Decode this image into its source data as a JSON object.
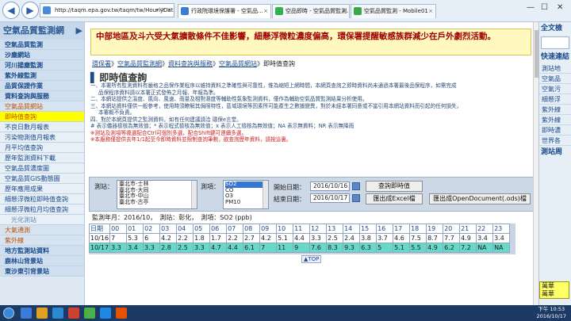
{
  "browser": {
    "url": "http://taqm.epa.gov.tw/taqm/tw/HourlyData.aspx",
    "tabs": [
      {
        "label": "行政院環境保護署 - 空氣品...",
        "color": "#3a7bd5"
      },
      {
        "label": "空品即時 - 空氣品質監測...",
        "color": "#2eb24a"
      },
      {
        "label": "空氣品質監測 - Mobile01",
        "color": "#3aa84a"
      }
    ],
    "tab_close": "×",
    "icons": {
      "back": "back-arrow-icon",
      "forward": "forward-arrow-icon"
    },
    "back_glyph": "◀",
    "forward_glyph": "▶",
    "addr_controls": "▾ ⟳ ✕",
    "win_min": "—",
    "win_max": "☐",
    "win_close": "✕"
  },
  "sidebar": {
    "brand": "空氣品質監測網",
    "brand_arrow": "▶",
    "items": [
      {
        "label": "空氣品質監測",
        "type": "header"
      },
      {
        "label": "沙塵網站",
        "type": "header"
      },
      {
        "label": "河川揚塵監測",
        "type": "header"
      },
      {
        "label": "紫外線監測",
        "type": "header"
      },
      {
        "label": "品質保證作業",
        "type": "header"
      },
      {
        "label": "資料查詢與服務",
        "type": "header"
      },
      {
        "label": "空氣品質網站",
        "type": "sec"
      },
      {
        "label": "即時值查詢",
        "type": "hl"
      },
      {
        "label": "不良日數月報表",
        "type": "plain"
      },
      {
        "label": "污染物測值月報表",
        "type": "plain"
      },
      {
        "label": "月平均值查詢",
        "type": "plain"
      },
      {
        "label": "歷年監測資料下載",
        "type": "plain"
      },
      {
        "label": "空氣品質濃度圖",
        "type": "plain"
      },
      {
        "label": "空氣品質GIS動態圖",
        "type": "plain"
      },
      {
        "label": "歷年應用成果",
        "type": "plain"
      },
      {
        "label": "細懸浮微粒即時值查詢",
        "type": "plain"
      },
      {
        "label": "細懸浮微粒月均值查詢",
        "type": "plain"
      },
      {
        "label": "光化測站",
        "type": "dim"
      },
      {
        "label": "大氣通測",
        "type": "sec"
      },
      {
        "label": "紫外線",
        "type": "sec"
      },
      {
        "label": "地方監測站資料",
        "type": "header"
      },
      {
        "label": "鹿林山背景站",
        "type": "header"
      },
      {
        "label": "東沙東引背景站",
        "type": "header"
      }
    ]
  },
  "banner": {
    "text": "中部地區及斗六受大氣擴散條件不佳影響，細懸浮微粒濃度偏高，環保署提醒敏感族群減少在戶外劇烈活動。"
  },
  "breadcrumb": {
    "items": [
      "環保署",
      "空氣品質監測網",
      "資料查詢與服務",
      "空氣品質網站",
      "即時值查詢"
    ],
    "sep": "》"
  },
  "page": {
    "title": "即時值查詢",
    "title_marker": "▌"
  },
  "notes": [
    {
      "text": "一、本署所有監測資料有嚴格之品保作業程序以維持資料之準確性與可靠性，惟為縮短上網時間，本網頁查詢之即時資料尚未通過本署最後品保程序，如需完成",
      "cls": ""
    },
    {
      "text": "品保程序資料請以本署正式發佈之月報、年報為準。",
      "cls": "ind"
    },
    {
      "text": "二、本網站提供之溫度、風向、風速、雨量及相對濕度等輔助性氣象監測資料，僅作為輔助空氣品質監測結果分析使用。",
      "cls": ""
    },
    {
      "text": "三、本網站資料僅供一般參考，使用時須瞭解其侷限特性，區域環境等因素所可能產生之數據變異，對於未經本署同意或不當引用本網站資料而引起的任何損失，",
      "cls": ""
    },
    {
      "text": "本署概不負責。",
      "cls": "ind"
    },
    {
      "text": "四、對於本網頁提供之監測資料，如有任何建議請洽  環保e言堂。",
      "cls": ""
    },
    {
      "text": "# 表示儀器檢核為無效值；* 表示程式檢核為無效值；x 表示人工檢核為無效值；NA 表示無資料；NR 表示無降雨",
      "cls": ""
    },
    {
      "text": "※測站及測項等複選配合Ctrl可個別多選，配合Shift鍵可連續多選。",
      "cls": "red"
    },
    {
      "text": "※本服務僅提供去年1/1起至今即時資料並限制查詢筆數，欲查詢歷年資料，請按這裏。",
      "cls": "red"
    }
  ],
  "filter": {
    "station_label": "測站：",
    "stations": [
      "臺北市-士林",
      "臺北市-大同",
      "臺北市-中山",
      "臺北市-古亭"
    ],
    "item_label": "測項：",
    "items": [
      "SO2",
      "CO",
      "O3",
      "PM10"
    ],
    "item_selected": 0,
    "start_label": "開始日期：",
    "start_date": "2016/10/16",
    "end_label": "結束日期：",
    "end_date": "2016/10/17",
    "query_button": "查詢即時值",
    "excel_button": "匯出成Excel檔",
    "ods_button": "匯出成OpenDocument(.ods)檔"
  },
  "result": {
    "status": "監測年月：2016/10，　測站：彰化，　測項：SO2 (ppb)",
    "headers": [
      "日期",
      "00",
      "01",
      "02",
      "03",
      "04",
      "05",
      "06",
      "07",
      "08",
      "09",
      "10",
      "11",
      "12",
      "13",
      "14",
      "15",
      "16",
      "17",
      "18",
      "19",
      "20",
      "21",
      "22",
      "23"
    ],
    "rows": [
      [
        "10/16",
        "7",
        "5.3",
        "6",
        "4.2",
        "2.2",
        "1.8",
        "1.7",
        "2.2",
        "2.7",
        "4.2",
        "5.1",
        "4.4",
        "3.3",
        "2.5",
        "2.4",
        "3.8",
        "3.7",
        "4.6",
        "7.5",
        "8.7",
        "7.7",
        "4.9",
        "3.4",
        "3.4"
      ],
      [
        "10/17",
        "3.3",
        "3.4",
        "3.3",
        "2.8",
        "2.5",
        "3.3",
        "4.7",
        "4.4",
        "6.1",
        "7",
        "11",
        "9",
        "7.6",
        "8.3",
        "9.3",
        "6.3",
        "5",
        "5.1",
        "5.5",
        "4.9",
        "6.2",
        "7.2",
        "NA",
        "NA"
      ]
    ],
    "top_label": "▲TOP"
  },
  "right_panel": {
    "header1": "全文檢",
    "header2": "快速連結",
    "items": [
      "測站地",
      "空氣品",
      "空氣污",
      "細懸浮",
      "紫外線",
      "紫外線",
      "即時濃",
      "世界各"
    ],
    "header3": "測站周",
    "footer_items": [
      "萬華",
      "萬華"
    ]
  },
  "taskbar": {
    "time": "下午 10:53",
    "date": "2016/10/17",
    "apps": [
      {
        "color": "#3c7bd8"
      },
      {
        "color": "#e0a020"
      },
      {
        "color": "#2a8ad0"
      },
      {
        "color": "#d04030"
      },
      {
        "color": "#4ab04a"
      },
      {
        "color": "#1e88e5"
      },
      {
        "color": "#e65100"
      }
    ]
  }
}
